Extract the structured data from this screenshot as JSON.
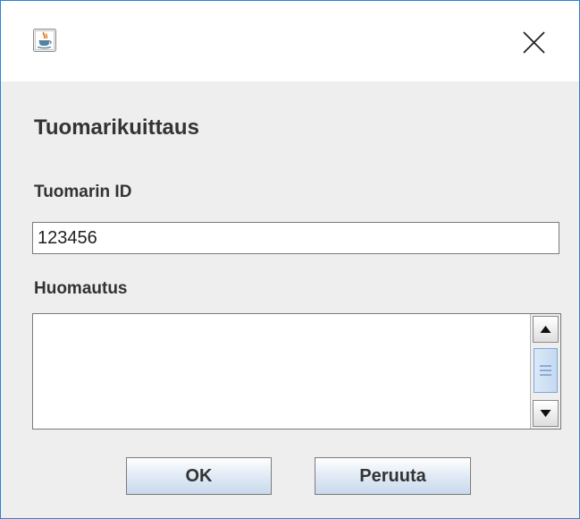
{
  "window": {
    "app_icon": "java-cup-icon",
    "close_icon": "close-x-icon"
  },
  "dialog": {
    "heading": "Tuomarikuittaus",
    "judge_id_label": "Tuomarin ID",
    "judge_id_value": "123456",
    "note_label": "Huomautus",
    "note_value": ""
  },
  "buttons": {
    "ok_label": "OK",
    "cancel_label": "Peruuta"
  },
  "colors": {
    "window_border": "#2b83d6",
    "panel_background": "#eeeeee",
    "button_gradient_bottom": "#c9d9ec",
    "scroll_thumb": "#c4d9f1"
  }
}
